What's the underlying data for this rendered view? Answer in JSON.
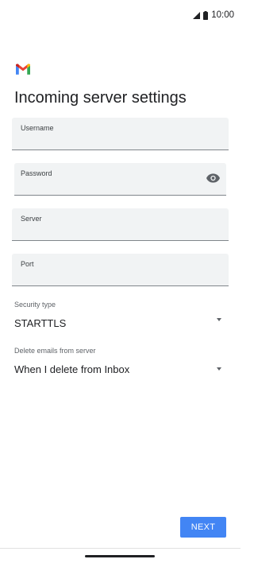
{
  "status_bar": {
    "time": "10:00"
  },
  "header": {
    "title": "Incoming server settings",
    "logo_icon": "gmail-logo-icon"
  },
  "fields": {
    "username": {
      "label": "Username",
      "value": ""
    },
    "password": {
      "label": "Password",
      "value": "",
      "toggle_icon": "eye-icon"
    },
    "server": {
      "label": "Server",
      "value": ""
    },
    "port": {
      "label": "Port",
      "value": ""
    }
  },
  "security_type": {
    "label": "Security type",
    "value": "STARTTLS"
  },
  "delete_emails": {
    "label": "Delete emails from server",
    "value": "When I delete from Inbox"
  },
  "actions": {
    "next_label": "NEXT"
  },
  "colors": {
    "accent": "#4285f4",
    "field_bg": "#f1f3f4"
  }
}
